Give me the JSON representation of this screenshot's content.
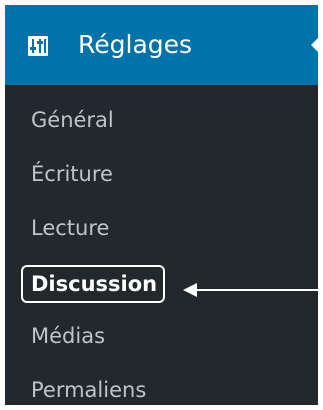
{
  "menu": {
    "header": {
      "label": "Réglages",
      "icon": "settings-sliders-icon"
    },
    "items": [
      {
        "label": "Général"
      },
      {
        "label": "Écriture"
      },
      {
        "label": "Lecture"
      },
      {
        "label": "Discussion"
      },
      {
        "label": "Médias"
      },
      {
        "label": "Permaliens"
      }
    ]
  },
  "colors": {
    "menu_background": "#23282d",
    "header_background": "#0073aa",
    "item_text": "#bfc4c8",
    "highlight": "#ffffff"
  }
}
